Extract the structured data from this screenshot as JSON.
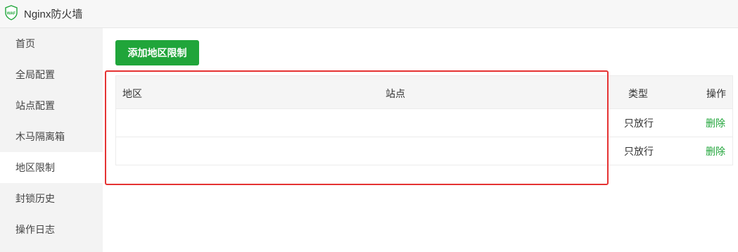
{
  "app": {
    "title": "Nginx防火墙",
    "logo_text": "WAF",
    "accent": "#20a53a"
  },
  "sidebar": {
    "items": [
      {
        "label": "首页"
      },
      {
        "label": "全局配置"
      },
      {
        "label": "站点配置"
      },
      {
        "label": "木马隔离箱"
      },
      {
        "label": "地区限制",
        "active": true
      },
      {
        "label": "封锁历史"
      },
      {
        "label": "操作日志"
      }
    ]
  },
  "toolbar": {
    "add_label": "添加地区限制"
  },
  "table": {
    "headers": {
      "region": "地区",
      "site": "站点",
      "type": "类型",
      "action": "操作"
    },
    "rows": [
      {
        "region": "",
        "site": "",
        "type": "只放行",
        "action": "删除"
      },
      {
        "region": "",
        "site": "",
        "type": "只放行",
        "action": "删除"
      }
    ]
  },
  "highlight_color": "#e53333"
}
